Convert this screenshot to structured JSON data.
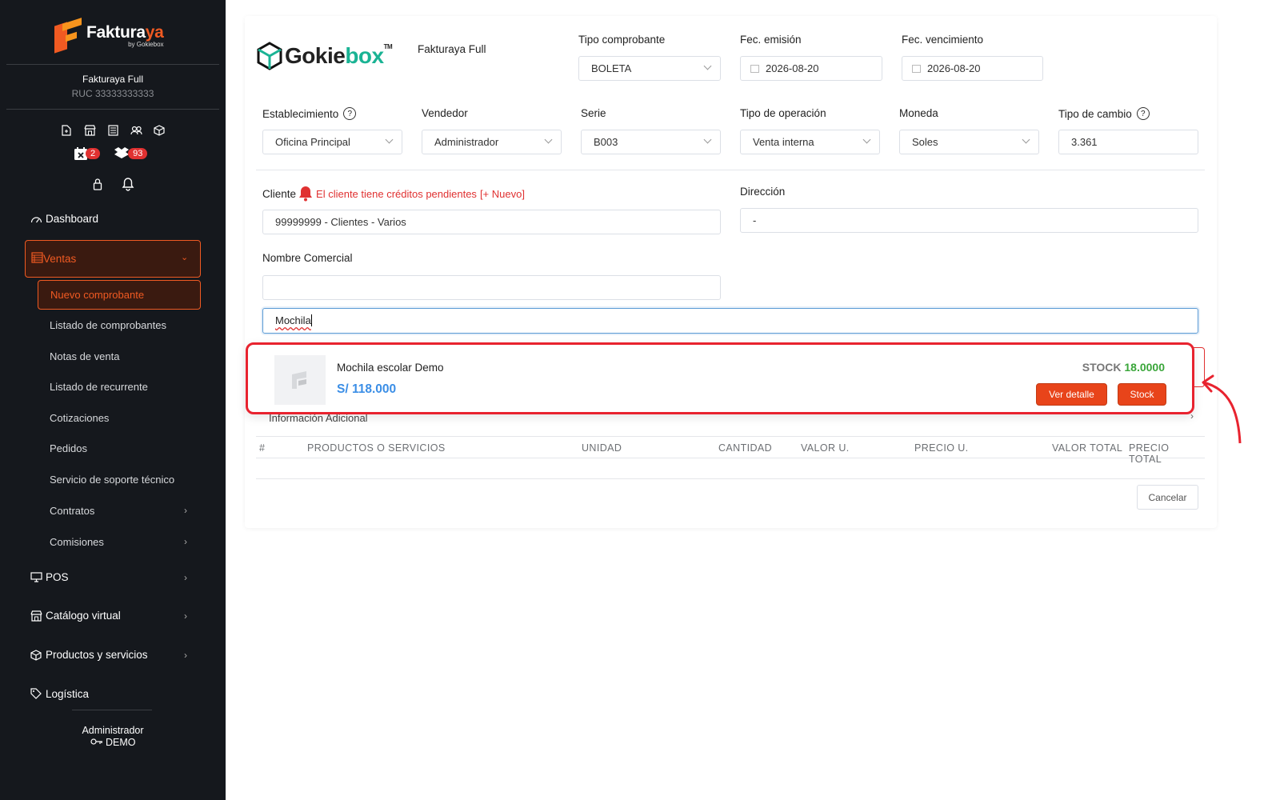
{
  "brand": {
    "name_main": "Faktura",
    "name_accent": "ya",
    "by": "by Gokiebox"
  },
  "sidebar": {
    "company_name": "Fakturaya Full",
    "ruc": "RUC 33333333333",
    "badges": {
      "calendar": "2",
      "boxes": "93"
    },
    "nav": {
      "dashboard": "Dashboard",
      "ventas": "Ventas",
      "ventas_sub": {
        "nuevo": "Nuevo comprobante",
        "listado": "Listado de comprobantes",
        "notas": "Notas de venta",
        "recurrente": "Listado de recurrente",
        "cotizaciones": "Cotizaciones",
        "pedidos": "Pedidos",
        "soporte": "Servicio de soporte técnico",
        "contratos": "Contratos",
        "comisiones": "Comisiones"
      },
      "pos": "POS",
      "catalogo": "Catálogo virtual",
      "productos": "Productos y servicios",
      "logistica": "Logística"
    },
    "user": {
      "role": "Administrador",
      "name": "DEMO"
    }
  },
  "form": {
    "logo": {
      "main": "Gokie",
      "accent": "box",
      "tm": "TM"
    },
    "company": "Fakturaya Full",
    "tipo_comprobante": {
      "label": "Tipo comprobante",
      "value": "BOLETA"
    },
    "fec_emision": {
      "label": "Fec. emisión",
      "value": "2026-08-20"
    },
    "fec_vencimiento": {
      "label": "Fec. vencimiento",
      "value": "2026-08-20"
    },
    "establecimiento": {
      "label": "Establecimiento",
      "value": "Oficina Principal"
    },
    "vendedor": {
      "label": "Vendedor",
      "value": "Administrador"
    },
    "serie": {
      "label": "Serie",
      "value": "B003"
    },
    "tipo_operacion": {
      "label": "Tipo de operación",
      "value": "Venta interna"
    },
    "moneda": {
      "label": "Moneda",
      "value": "Soles"
    },
    "tipo_cambio": {
      "label": "Tipo de cambio",
      "value": "3.361"
    },
    "cliente": {
      "label": "Cliente",
      "warning": "El cliente tiene créditos pendientes",
      "new": "[+ Nuevo]",
      "value": "99999999 - Clientes - Varios"
    },
    "direccion": {
      "label": "Dirección",
      "value": "-"
    },
    "nombre_comercial": {
      "label": "Nombre Comercial",
      "value": ""
    },
    "search_value": "Mochila",
    "info_adicional": "Información Adicional",
    "table_headers": [
      "#",
      "PRODUCTOS O SERVICIOS",
      "UNIDAD",
      "CANTIDAD",
      "VALOR U.",
      "PRECIO U.",
      "VALOR TOTAL",
      "PRECIO TOTAL"
    ],
    "cancel": "Cancelar"
  },
  "result": {
    "name": "Mochila escolar Demo",
    "price": "S/ 118.000",
    "stock_label": "STOCK",
    "stock_value": "18.0000",
    "btn_detail": "Ver detalle",
    "btn_stock": "Stock"
  },
  "colors": {
    "accent": "#f05a22",
    "sidebar_bg": "#15181d",
    "price": "#3b8ee6",
    "stock": "#3aa63a",
    "highlight": "#e8232f"
  }
}
